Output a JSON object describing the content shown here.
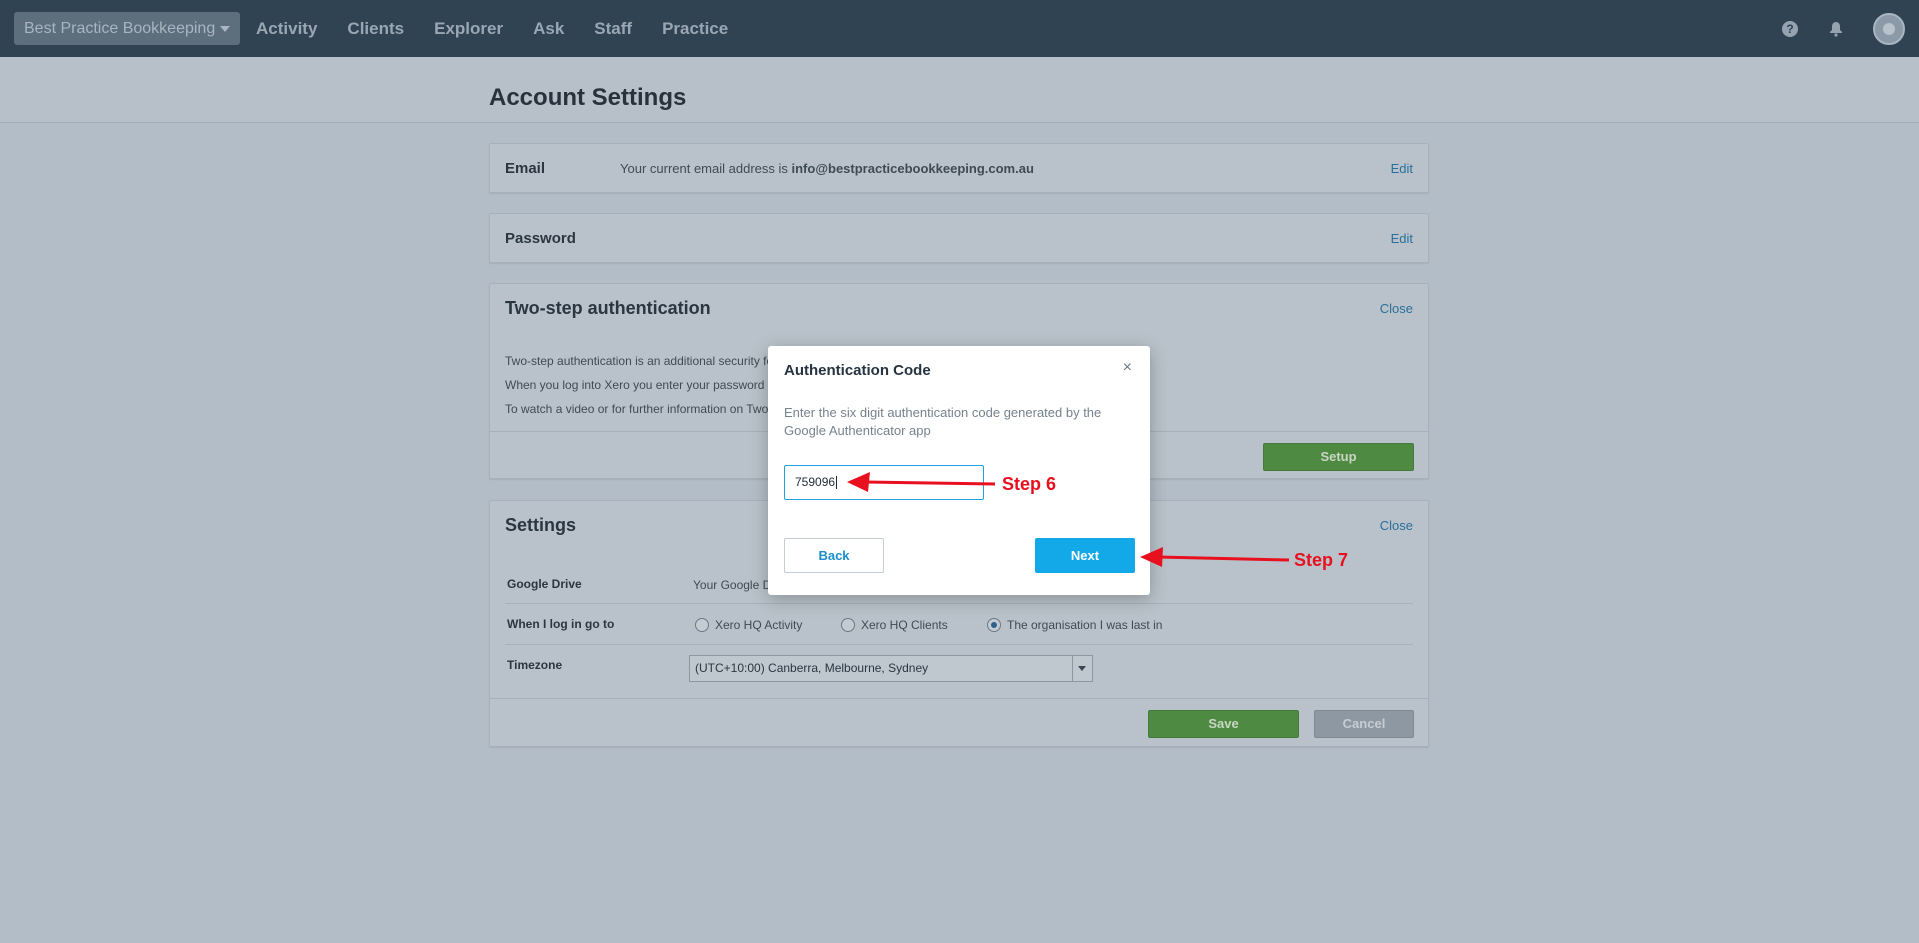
{
  "topbar": {
    "org_name": "Best Practice Bookkeeping",
    "nav": [
      "Activity",
      "Clients",
      "Explorer",
      "Ask",
      "Staff",
      "Practice"
    ],
    "icons": [
      "help-icon",
      "bell-icon",
      "avatar"
    ]
  },
  "page": {
    "title": "Account Settings"
  },
  "email_panel": {
    "label": "Email",
    "text_prefix": "Your current email address is ",
    "email": "info@bestpracticebookkeeping.com.au",
    "edit": "Edit"
  },
  "password_panel": {
    "label": "Password",
    "edit": "Edit"
  },
  "twostep_panel": {
    "title": "Two-step authentication",
    "close": "Close",
    "lines": [
      "Two-step authentication is an additional security fe",
      "When you log into Xero you enter your password",
      "To watch a video or for further information on Two"
    ],
    "setup": "Setup"
  },
  "settings_panel": {
    "title": "Settings",
    "close": "Close",
    "google_drive_label": "Google Drive",
    "google_drive_value": "Your Google D",
    "login_label": "When I log in go to",
    "login_options": [
      "Xero HQ Activity",
      "Xero HQ Clients",
      "The organisation I was last in"
    ],
    "login_selected": "The organisation I was last in",
    "timezone_label": "Timezone",
    "timezone_value": "(UTC+10:00) Canberra, Melbourne, Sydney",
    "save": "Save",
    "cancel": "Cancel"
  },
  "modal": {
    "title": "Authentication Code",
    "close_glyph": "×",
    "description": "Enter the six digit authentication code generated by the Google Authenticator app",
    "code_value": "759096",
    "back": "Back",
    "next": "Next"
  },
  "annotations": {
    "step6": "Step 6",
    "step7": "Step 7",
    "color": "#e8101f"
  },
  "colors": {
    "accent_blue": "#13a9e8",
    "green": "#4f8a42",
    "topbar": "#2f4353"
  }
}
